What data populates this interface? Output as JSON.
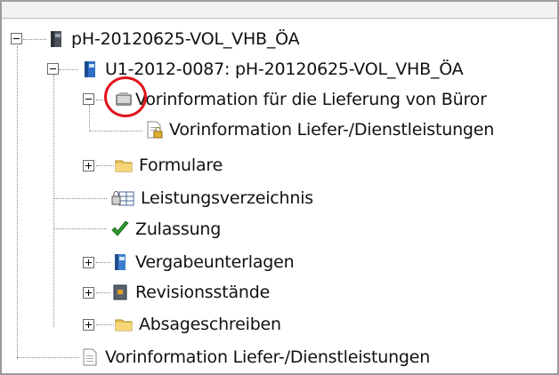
{
  "tree": {
    "root": {
      "label": "pH-20120625-VOL_VHB_ÖA",
      "icon": "binder-icon"
    },
    "project": {
      "label": "U1-2012-0087:  pH-20120625-VOL_VHB_ÖA",
      "icon": "binder-blue-icon"
    },
    "vorinfo_folder": {
      "label": "Vorinformation für die Lieferung von Büror",
      "icon": "scanner-icon"
    },
    "vorinfo_doc_locked": {
      "label": "Vorinformation Liefer-/Dienstleistungen",
      "icon": "locked-document-icon"
    },
    "formulare": {
      "label": "Formulare",
      "icon": "folder-icon"
    },
    "leistungsverzeichnis": {
      "label": "Leistungsverzeichnis",
      "icon": "locked-table-icon"
    },
    "zulassung": {
      "label": "Zulassung",
      "icon": "checkmark-icon"
    },
    "vergabeunterlagen": {
      "label": "Vergabeunterlagen",
      "icon": "binder-icon"
    },
    "revisionsstaende": {
      "label": "Revisionsstände",
      "icon": "archive-icon"
    },
    "absageschreiben": {
      "label": "Absageschreiben",
      "icon": "folder-icon"
    },
    "vorinfo_doc": {
      "label": "Vorinformation Liefer-/Dienstleistungen",
      "icon": "document-icon"
    }
  },
  "colors": {
    "highlight_circle": "#e0141b",
    "folder": "#e8c25a",
    "check": "#2a9a2a"
  }
}
